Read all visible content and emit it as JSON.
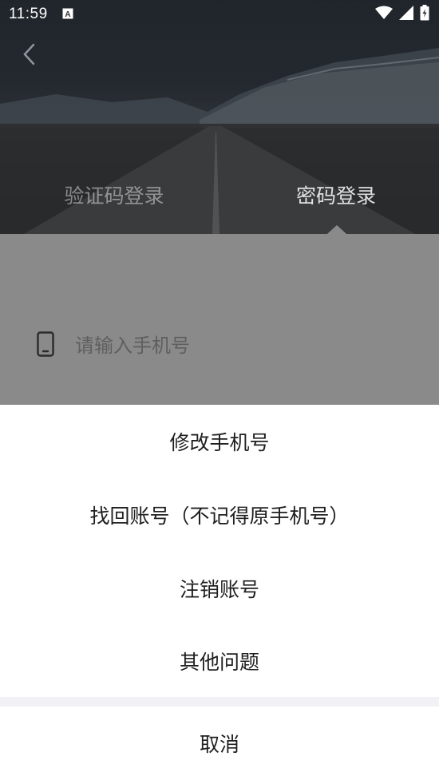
{
  "status_bar": {
    "time": "11:59",
    "notification_icon": "a-box-icon",
    "icons": [
      "wifi-icon",
      "signal-icon",
      "battery-charging-icon"
    ]
  },
  "header": {
    "back_icon": "chevron-left-icon"
  },
  "tabs": [
    {
      "label": "验证码登录",
      "active": false
    },
    {
      "label": "密码登录",
      "active": true
    }
  ],
  "form": {
    "phone_icon": "phone-icon",
    "phone_placeholder": "请输入手机号"
  },
  "action_sheet": {
    "items": [
      "修改手机号",
      "找回账号（不记得原手机号）",
      "注销账号",
      "其他问题"
    ],
    "cancel_label": "取消"
  },
  "colors": {
    "overlay": "#8a8a8a",
    "sheet_bg": "#ffffff",
    "sheet_gap": "#f2f2f6",
    "text": "#1f1f1f"
  }
}
